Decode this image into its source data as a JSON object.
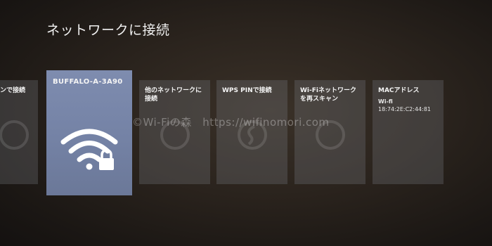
{
  "page_title": "ネットワークに接続",
  "tiles": [
    {
      "label": "ンで接続"
    },
    {
      "label": "BUFFALO-A-3A90",
      "icon": "wifi-lock-icon",
      "selected": true
    },
    {
      "label": "他のネットワークに\n接続"
    },
    {
      "label": "WPS PINで接続"
    },
    {
      "label": "Wi-Fiネットワーク\nを再スキャン"
    },
    {
      "label": "MACアドレス",
      "sub_title": "Wi-fi",
      "sub_value": "18:74:2E:C2:44:81"
    }
  ],
  "watermark": "©Wi-Fiの森　https://wifinomori.com",
  "colors": {
    "selected_tile": "#7a88ab",
    "tile": "#4a4a4f",
    "background": "#2a231d"
  }
}
